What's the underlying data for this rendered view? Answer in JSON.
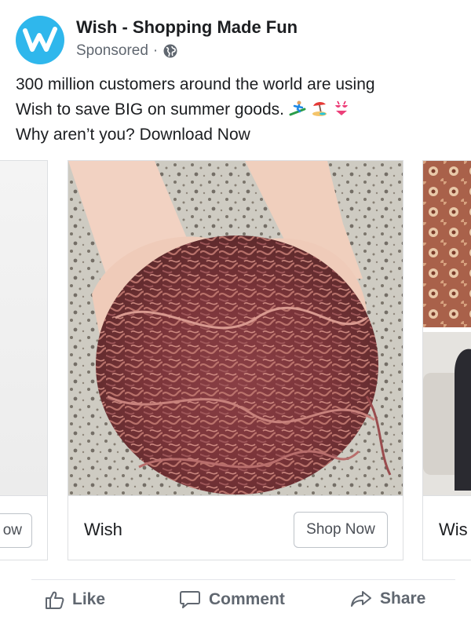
{
  "post": {
    "page_name": "Wish - Shopping Made Fun",
    "sponsored": "Sponsored",
    "separator": "·",
    "text_lines": [
      "300 million customers around the world are using",
      "Wish to save BIG on summer goods.",
      "Why aren’t you? Download Now"
    ],
    "emojis": [
      "surfer-emoji",
      "beach-umbrella-emoji",
      "bikini-emoji"
    ]
  },
  "carousel": {
    "cards": [
      {
        "title": "",
        "cta": "ow",
        "image": "partial-card"
      },
      {
        "title": "Wish",
        "cta": "Shop Now",
        "image": "hands-holding-worms-photo"
      },
      {
        "title": "Wis",
        "cta": "",
        "image": "partial-card-floral-and-sofa"
      }
    ]
  },
  "actions": {
    "like": "Like",
    "comment": "Comment",
    "share": "Share"
  },
  "colors": {
    "wish_blue": "#2fb7ec",
    "text": "#1c1e21",
    "secondary": "#606770",
    "border": "#dddfe2"
  }
}
